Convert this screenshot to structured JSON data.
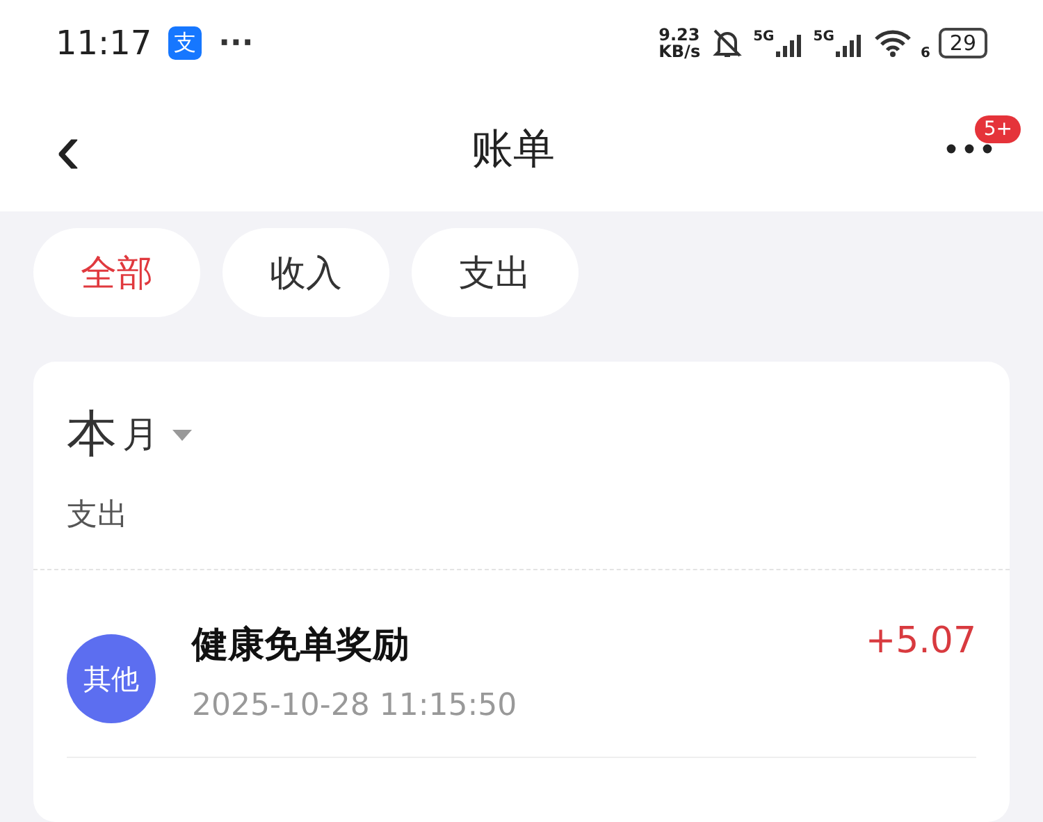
{
  "status_bar": {
    "time": "11:17",
    "app_badge": "支",
    "more": "···",
    "speed_value": "9.23",
    "speed_unit": "KB/s",
    "signal_labels": [
      "5G",
      "5G"
    ],
    "wifi_label": "6",
    "battery": "29"
  },
  "header": {
    "back": "‹",
    "title": "账单",
    "notification_badge": "5+"
  },
  "filters": [
    {
      "label": "全部",
      "selected": true
    },
    {
      "label": "收入",
      "selected": false
    },
    {
      "label": "支出",
      "selected": false
    }
  ],
  "summary": {
    "period": "本",
    "period_unit": "月",
    "subtitle": "支出"
  },
  "transactions": [
    {
      "category": "其他",
      "title": "健康免单奖励",
      "time": "2025-10-28 11:15:50",
      "amount": "+5.07"
    }
  ]
}
